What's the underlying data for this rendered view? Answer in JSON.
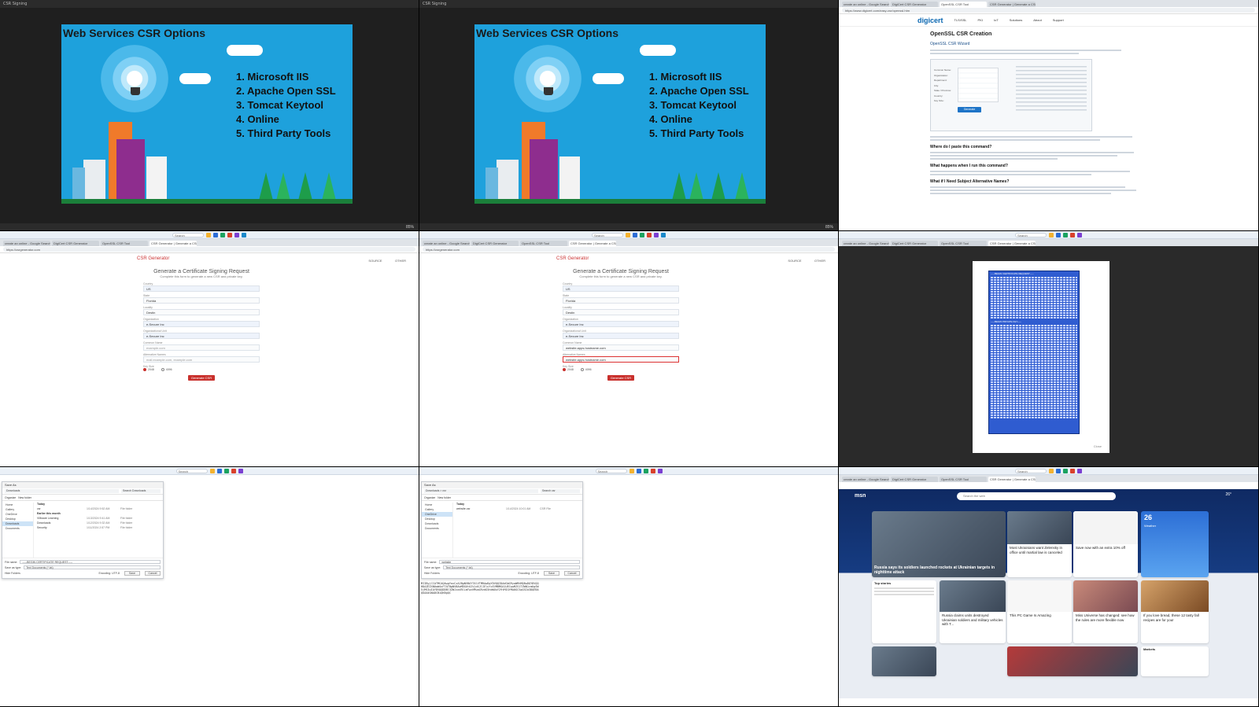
{
  "slide": {
    "title": "Web Services CSR Options",
    "items": [
      "1. Microsoft IIS",
      "2. Apache Open SSL",
      "3. Tomcat Keytool",
      "4. Online",
      "5. Third Party Tools"
    ],
    "zoom_label": "85%",
    "window_title": "CSR Signing"
  },
  "browser": {
    "tabs": [
      "create an online - Google Search",
      "DigiCert CSR Generator",
      "OpenSSL CSR Tool",
      "CSR Generator | Generate a CSR"
    ],
    "digicert_url": "https://www.digicert.com/easy-csr/openssl.htm",
    "csr_url": "https://csrgenerator.com",
    "search_placeholder": "Search"
  },
  "digicert": {
    "logo": "digicert",
    "nav": [
      "TLS/SSL",
      "PKI",
      "IoT",
      "Solutions",
      "About",
      "Support"
    ],
    "title": "OpenSSL CSR Creation",
    "subtitle": "OpenSSL CSR Wizard",
    "button": "Generate",
    "h_paste": "Where do I paste this command?",
    "h_happens": "What happens when I run this command?",
    "h_san": "What if I Need Subject Alternative Names?",
    "fields": [
      "Common Name:",
      "Organization:",
      "Department:",
      "City:",
      "State / Province:",
      "Country:",
      "Key Size:"
    ]
  },
  "csr": {
    "brand": "CSR Generator",
    "links": [
      "SOURCE",
      "OTHER"
    ],
    "title": "Generate a Certificate Signing Request",
    "subtitle": "Complete this form to generate a new CSR and private key.",
    "fields": [
      {
        "label": "Country",
        "value": "US"
      },
      {
        "label": "State",
        "value": "Florida"
      },
      {
        "label": "Locality",
        "value": "Destin"
      },
      {
        "label": "Organization",
        "value": "e-Secure Inc"
      },
      {
        "label": "Organizational Unit",
        "value": "e-Secure Inc"
      }
    ],
    "common_name_label": "Common Name",
    "common_name_left": "example.com",
    "common_name_right": "website.apps.hostname.com",
    "alt_label": "Alternative Names",
    "alt_left": "mail.example.com, example.com",
    "alt_right": "website.apps.hostname.com",
    "keysize_label": "Key Size",
    "key_2048": "2048",
    "key_4096": "4096",
    "button": "Generate CSR"
  },
  "result": {
    "header_line": "-----BEGIN CERTIFICATE REQUEST-----",
    "mid_line": "-----BEGIN PRIVATE KEY-----",
    "close": "Close"
  },
  "explorer_left": {
    "title": "Save As",
    "crumb": "Downloads",
    "search": "Search Downloads",
    "organize": "Organize",
    "new_folder": "New folder",
    "sidebar": [
      "Home",
      "Gallery",
      "OneDrive",
      "Desktop",
      "Downloads",
      "Documents"
    ],
    "group_today": "Today",
    "group_earlier": "Earlier this month",
    "rows": [
      {
        "name": "csr",
        "date": "1/14/2024 9:52 AM",
        "type": "File folder"
      },
      {
        "name": "VMware Learning",
        "date": "1/13/2024 9:41 AM",
        "type": "File folder"
      },
      {
        "name": "Downloads",
        "date": "1/12/2024 9:32 AM",
        "type": "File folder"
      },
      {
        "name": "Security",
        "date": "1/11/2024 2:57 PM",
        "type": "File folder"
      }
    ],
    "filename_label": "File name:",
    "filename": "-----BEGIN CERTIFICATE REQUEST-----",
    "savetype_label": "Save as type:",
    "savetype": "Text Documents (*.txt)",
    "encoding": "Encoding: UTF-8",
    "save": "Save",
    "cancel": "Cancel",
    "hide": "Hide Folders"
  },
  "explorer_right": {
    "crumb": "Downloads > csr",
    "search": "Search csr",
    "group_today": "Today",
    "rows": [
      {
        "name": "website.csr",
        "date": "1/14/2024 10:01 AM",
        "type": "CSR File"
      }
    ],
    "filename": "website",
    "code_text": "MIIByjCCATMCAQAwgYoxCzAJBgNVBAYTAlVTMRAwDgYDVQQIDAdGbG9yaWRhMQ8wDQYDVQQHDAZEZXN0aW4xFTATBgNVBAoMDGUtU2VjdXJlIEluYzEVMBMGA1UECwwMZS1TZWN1cmUgSW5jMSIwIAYDVQQDDBl3ZWJzaXRlLmFwcHMuaG9zdG5hbWUuY29tMIGfMA0GCSqGSIb3DQEBAQUAA4GNADCBiQKBgQC"
  },
  "msn": {
    "brand": "msn",
    "search_placeholder": "Search the web",
    "weather_top": "26°",
    "headlines": [
      "Russia says its soldiers launched rockets at Ukrainian targets in nighttime attack",
      "Most Ukrainians want Zelensky in office until martial law is canceled",
      "Save now with an extra 10% off",
      "Russia claims units destroyed Ukrainian soldiers and military vehicles with T...",
      "This PC Game Is Amazing",
      "Miss Universe has changed: see how the rules are more flexible now",
      "If you love bread, these 12 tasty fall recipes are for you!"
    ],
    "trending": "Top stories",
    "markets": "Markets",
    "weather_temp": "26",
    "weather_label": "Weather"
  },
  "colors": {
    "slide_bg": "#1ea1dc",
    "csr_red": "#c9302c",
    "digicert_blue": "#0a67b1",
    "selection_blue": "#2f5cd0"
  }
}
